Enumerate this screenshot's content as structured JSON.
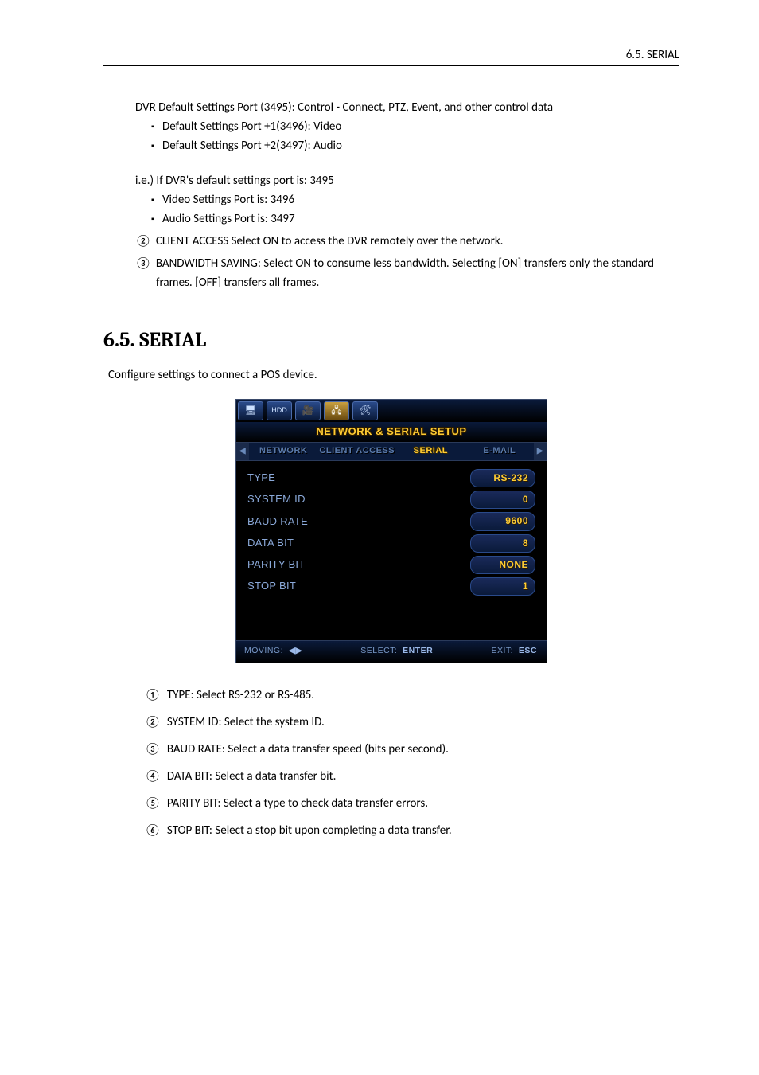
{
  "header": {
    "right": "6.5. SERIAL"
  },
  "body": {
    "p1": "DVR Default Settings Port (3495): Control - Connect, PTZ, Event, and other control data",
    "b1": "Default Settings Port +1(3496): Video",
    "b2": "Default Settings Port +2(3497): Audio",
    "p2": "i.e.) If DVR's default settings port is: 3495",
    "b3": "Video Settings Port is: 3496",
    "b4": "Audio Settings Port is: 3497",
    "n2": {
      "num": "②",
      "txt": "CLIENT ACCESS Select ON to access the DVR remotely over the network."
    },
    "n3": {
      "num": "③",
      "txt": "BANDWIDTH SAVING: Select ON to consume less bandwidth. Selecting [ON] transfers only the standard frames. [OFF] transfers all frames."
    }
  },
  "section": {
    "title": "6.5. SERIAL",
    "intro": "Configure settings to connect a POS device."
  },
  "dvr": {
    "title": "NETWORK & SERIAL SETUP",
    "tabs": [
      "NETWORK",
      "CLIENT ACCESS",
      "SERIAL",
      "E-MAIL"
    ],
    "rows": [
      {
        "label": "TYPE",
        "value": "RS-232"
      },
      {
        "label": "SYSTEM ID",
        "value": "0"
      },
      {
        "label": "BAUD RATE",
        "value": "9600"
      },
      {
        "label": "DATA BIT",
        "value": "8"
      },
      {
        "label": "PARITY BIT",
        "value": "NONE"
      },
      {
        "label": "STOP BIT",
        "value": "1"
      }
    ],
    "footer": {
      "moving_l": "MOVING:",
      "moving_v": "◀▶",
      "select_l": "SELECT:",
      "select_v": "ENTER",
      "exit_l": "EXIT:",
      "exit_v": "ESC"
    }
  },
  "figlist": [
    {
      "num": "①",
      "txt": "TYPE: Select RS-232 or RS-485."
    },
    {
      "num": "②",
      "txt": "SYSTEM ID: Select the system ID."
    },
    {
      "num": "③",
      "txt": "BAUD RATE: Select a data transfer speed (bits per second)."
    },
    {
      "num": "④",
      "txt": "DATA BIT: Select a data transfer bit."
    },
    {
      "num": "⑤",
      "txt": "PARITY BIT: Select a type to check data transfer errors."
    },
    {
      "num": "⑥",
      "txt": "STOP BIT: Select a stop bit upon completing a data transfer."
    }
  ]
}
